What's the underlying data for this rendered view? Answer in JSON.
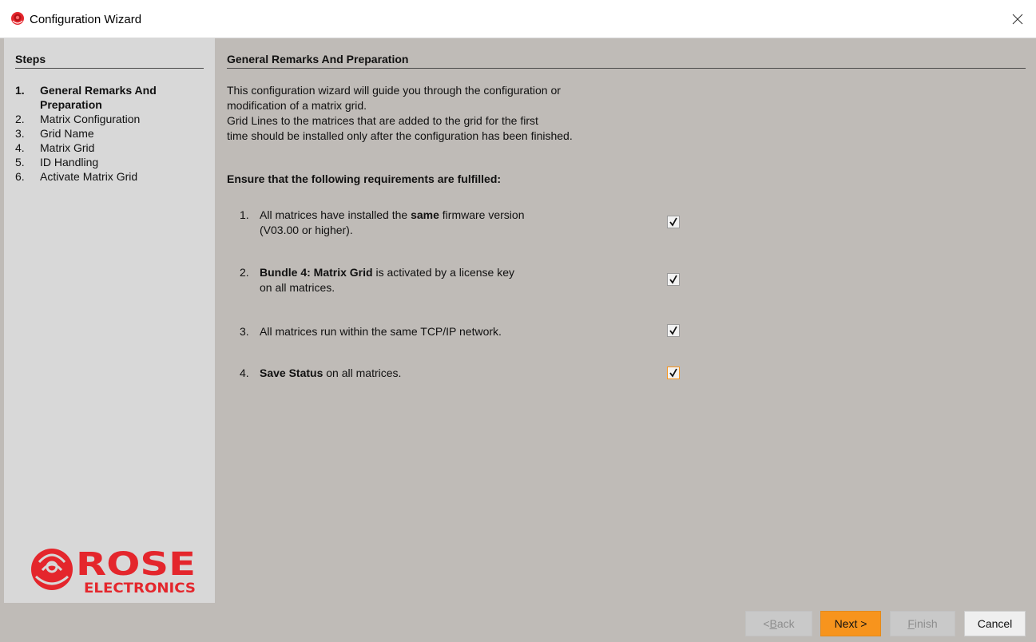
{
  "window": {
    "title": "Configuration Wizard"
  },
  "sidebar": {
    "heading": "Steps",
    "steps": [
      {
        "num": "1.",
        "label": "General Remarks And Preparation",
        "active": true
      },
      {
        "num": "2.",
        "label": "Matrix Configuration"
      },
      {
        "num": "3.",
        "label": "Grid Name"
      },
      {
        "num": "4.",
        "label": "Matrix Grid"
      },
      {
        "num": "5.",
        "label": "ID Handling"
      },
      {
        "num": "6.",
        "label": "Activate Matrix Grid"
      }
    ],
    "logo": {
      "brand": "ROSE",
      "sub": "ELECTRONICS"
    }
  },
  "main": {
    "heading": "General Remarks And Preparation",
    "intro_lines": [
      "This configuration wizard will guide you through the configuration or",
      "modification of a matrix grid.",
      "Grid Lines to the matrices that are added to the grid for the first",
      "time should be installed only after the configuration has been finished."
    ],
    "requirements_heading": "Ensure that the following requirements are fulfilled:",
    "requirements": [
      {
        "num": "1.",
        "pre": "All matrices have installed the ",
        "bold": "same",
        "post": " firmware version",
        "line2": "(V03.00 or higher).",
        "checked": true
      },
      {
        "num": "2.",
        "pre": "",
        "bold": "Bundle 4: Matrix Grid",
        "post": " is activated by a license key",
        "line2": "on all matrices.",
        "checked": true
      },
      {
        "num": "3.",
        "pre": "All matrices run within the same TCP/IP network.",
        "bold": "",
        "post": "",
        "line2": "",
        "checked": true
      },
      {
        "num": "4.",
        "pre": "",
        "bold": "Save Status",
        "post": " on all matrices.",
        "line2": "",
        "checked": true
      }
    ]
  },
  "buttons": {
    "back": {
      "prefix": "< ",
      "mnemonic": "B",
      "rest": "ack"
    },
    "next": {
      "label": "Next >"
    },
    "finish": {
      "prefix": "",
      "mnemonic": "F",
      "rest": "inish"
    },
    "cancel": {
      "label": "Cancel"
    }
  },
  "colors": {
    "accent": "#f7941d",
    "background": "#bfbbb7",
    "sidebar": "#d8d8d8",
    "logo_red": "#e4262c"
  }
}
